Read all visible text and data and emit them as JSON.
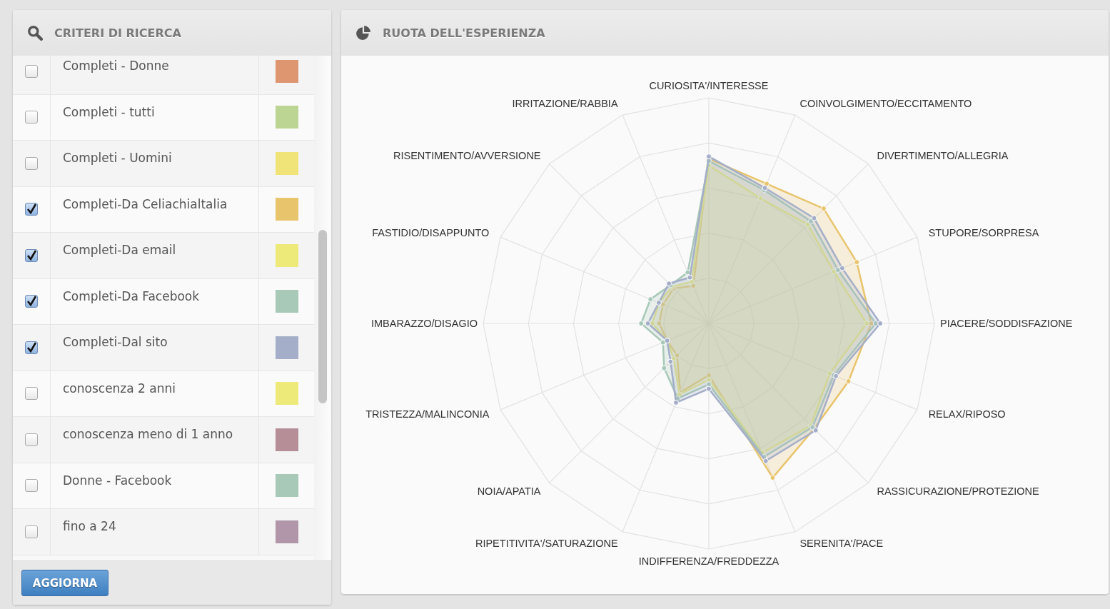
{
  "criteria_panel": {
    "title": "CRITERI DI RICERCA",
    "items": [
      {
        "label": "Completi - Donne",
        "checked": false,
        "color": "#dd9670"
      },
      {
        "label": "Completi - tutti",
        "checked": false,
        "color": "#bdd592"
      },
      {
        "label": "Completi - Uomini",
        "checked": false,
        "color": "#f0e478"
      },
      {
        "label": "Completi-Da Celiachialtalia",
        "checked": true,
        "color": "#e8c46c"
      },
      {
        "label": "Completi-Da email",
        "checked": true,
        "color": "#eeea7a"
      },
      {
        "label": "Completi-Da Facebook",
        "checked": true,
        "color": "#a8c8b8"
      },
      {
        "label": "Completi-Dal sito",
        "checked": true,
        "color": "#a4aec8"
      },
      {
        "label": "conoscenza 2 anni",
        "checked": false,
        "color": "#eeea7a"
      },
      {
        "label": "conoscenza meno di 1 anno",
        "checked": false,
        "color": "#b68e98"
      },
      {
        "label": "Donne - Facebook",
        "checked": false,
        "color": "#a8c8b8"
      },
      {
        "label": "fino a 24",
        "checked": false,
        "color": "#b096a8"
      }
    ],
    "button": "AGGIORNA"
  },
  "chart_panel": {
    "title": "RUOTA DELL'ESPERIENZA",
    "right_axes": [
      "CURIOSITA'/INTERESSE",
      "COINVOLGIMENTO/ECCITAMENTO",
      "DIVERTIMENTO/ALLEGRIA",
      "STUPORE/SORPRESA",
      "PIACERE/SODDISFAZIONE",
      "RELAX/RIPOSO",
      "RASSICURAZIONE/PROTEZIONE",
      "SERENITA'/PACE",
      "INDIFFERENZA/FREDDEZZA"
    ],
    "left_axes": [
      "IRRITAZIONE/RABBIA",
      "RISENTIMENTO/AVVERSIONE",
      "FASTIDIO/DISAPPUNTO",
      "IMBARAZZO/DISAGIO",
      "TRISTEZZA/MALINCONIA",
      "NOIA/APATIA",
      "RIPETITIVITA'/SATURAZIONE"
    ]
  }
}
